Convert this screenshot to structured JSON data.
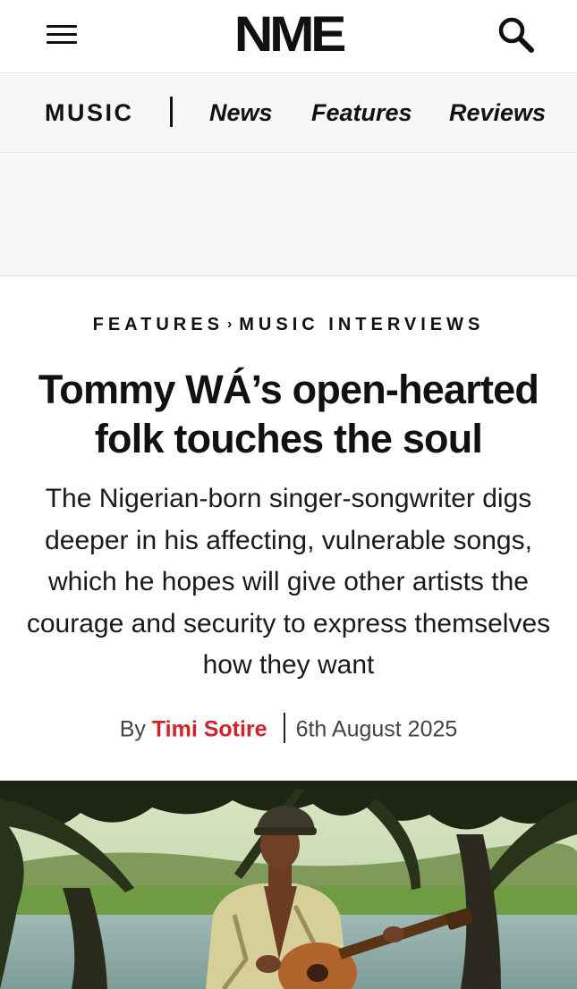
{
  "header": {
    "logo": "NME",
    "menu_icon": "hamburger-menu-icon",
    "search_icon": "search-icon"
  },
  "subnav": {
    "section": "MUSIC",
    "links": [
      "News",
      "Features",
      "Reviews"
    ]
  },
  "article": {
    "breadcrumb": {
      "category": "FEATURES",
      "separator": "›",
      "subcategory": "MUSIC INTERVIEWS"
    },
    "headline_line1": "Tommy WÁ’s open-hearted",
    "headline_line2": "folk touches the soul",
    "standfirst": "The Nigerian-born singer-songwriter digs deeper in his affecting, vulnerable songs, which he hopes will give other artists the courage and security to express themselves how they want",
    "byline": {
      "prefix": "By",
      "author": "Timi Sotire",
      "date": "6th August 2025"
    }
  },
  "colors": {
    "accent": "#d2232a",
    "text": "#111111",
    "nav_background": "#f7f7f7"
  }
}
